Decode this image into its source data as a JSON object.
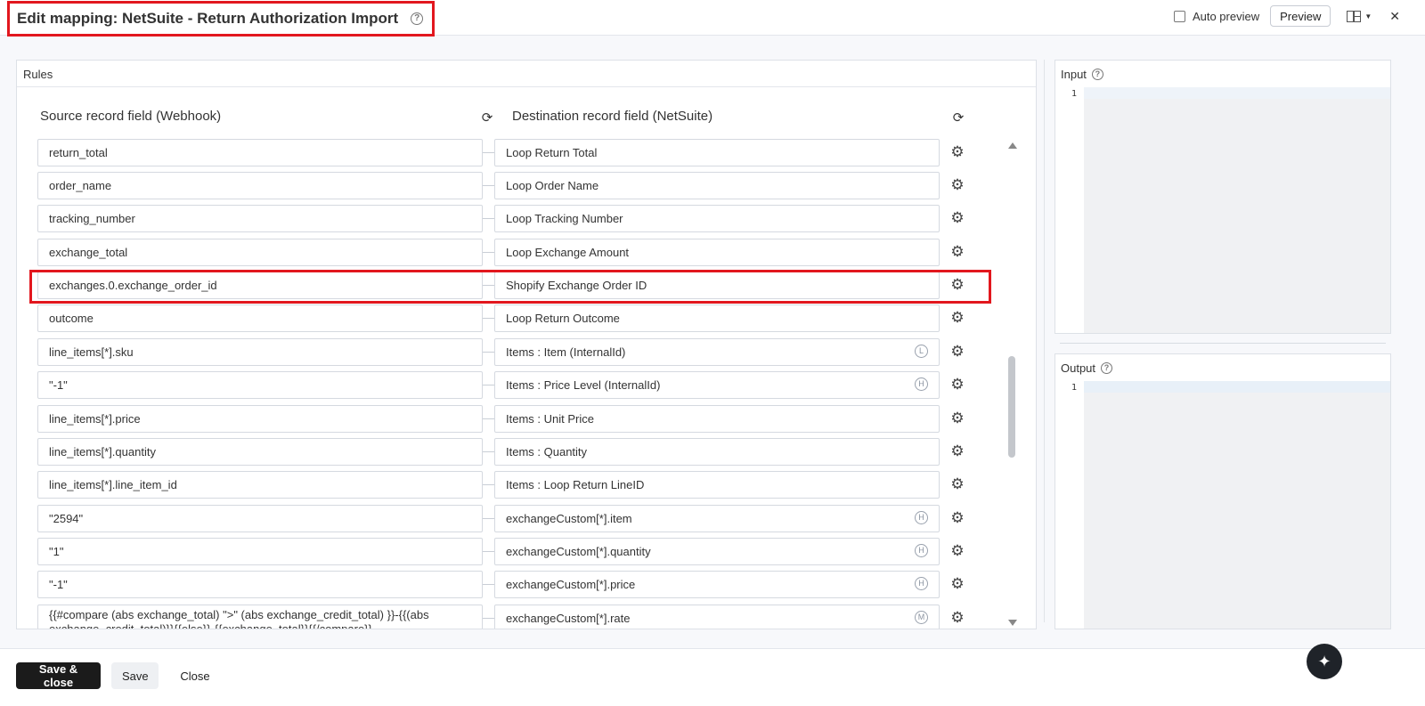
{
  "header": {
    "title": "Edit mapping: NetSuite - Return Authorization Import",
    "auto_preview_label": "Auto preview",
    "preview_label": "Preview"
  },
  "rules": {
    "panel_title": "Rules",
    "source_header": "Source record field (Webhook)",
    "destination_header": "Destination record field (NetSuite)",
    "rows": [
      {
        "source": "return_total",
        "destination": "Loop Return Total",
        "badge": ""
      },
      {
        "source": "order_name",
        "destination": "Loop Order Name",
        "badge": ""
      },
      {
        "source": "tracking_number",
        "destination": "Loop Tracking Number",
        "badge": ""
      },
      {
        "source": "exchange_total",
        "destination": "Loop Exchange Amount",
        "badge": ""
      },
      {
        "source": "exchanges.0.exchange_order_id",
        "destination": "Shopify Exchange Order ID",
        "badge": ""
      },
      {
        "source": "outcome",
        "destination": "Loop Return Outcome",
        "badge": ""
      },
      {
        "source": "line_items[*].sku",
        "destination": "Items : Item (InternalId)",
        "badge": "L"
      },
      {
        "source": "\"-1\"",
        "destination": "Items : Price Level (InternalId)",
        "badge": "H"
      },
      {
        "source": "line_items[*].price",
        "destination": "Items : Unit Price",
        "badge": ""
      },
      {
        "source": "line_items[*].quantity",
        "destination": "Items : Quantity",
        "badge": ""
      },
      {
        "source": "line_items[*].line_item_id",
        "destination": "Items : Loop Return LineID",
        "badge": ""
      },
      {
        "source": "\"2594\"",
        "destination": "exchangeCustom[*].item",
        "badge": "H"
      },
      {
        "source": "\"1\"",
        "destination": "exchangeCustom[*].quantity",
        "badge": "H"
      },
      {
        "source": "\"-1\"",
        "destination": "exchangeCustom[*].price",
        "badge": "H"
      },
      {
        "source": "{{#compare (abs exchange_total) \">\"  (abs exchange_credit_total) }}-{{(abs exchange_credit_total)}}{{else}}-{{exchange_total}}{{/compare}}",
        "destination": "exchangeCustom[*].rate",
        "badge": "M"
      }
    ]
  },
  "input_pane": {
    "title": "Input",
    "line": "1"
  },
  "output_pane": {
    "title": "Output",
    "line": "1"
  },
  "footer": {
    "save_close": "Save & close",
    "save": "Save",
    "close": "Close"
  },
  "icons": {
    "help": "help-circle-icon",
    "refresh": "refresh-icon",
    "settings": "gear-icon",
    "layout": "layout-icon",
    "close": "close-icon",
    "assistant": "sparkle-icon"
  },
  "colors": {
    "highlight": "#e2171e",
    "primary_button": "#1b1b1b"
  }
}
